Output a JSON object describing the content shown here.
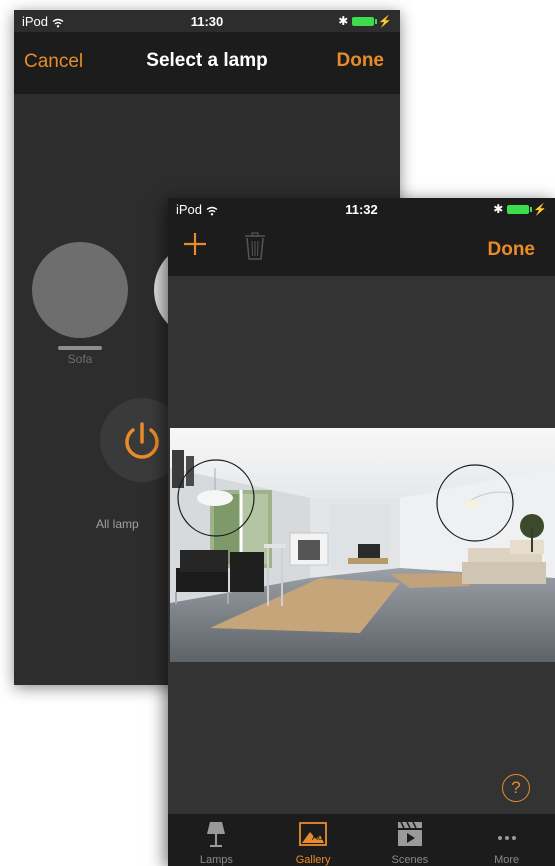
{
  "back_screen": {
    "status": {
      "carrier": "iPod",
      "time": "11:30"
    },
    "nav": {
      "cancel_label": "Cancel",
      "title": "Select a lamp",
      "done_label": "Done"
    },
    "lamps": [
      {
        "name": "Sofa"
      }
    ],
    "all_lamps_label": "All lamp"
  },
  "front_screen": {
    "status": {
      "carrier": "iPod",
      "time": "11:32"
    },
    "nav": {
      "done_label": "Done"
    },
    "help_label": "?",
    "tabs": [
      {
        "label": "Lamps",
        "icon": "lamp-icon",
        "active": false
      },
      {
        "label": "Gallery",
        "icon": "gallery-icon",
        "active": true
      },
      {
        "label": "Scenes",
        "icon": "scenes-icon",
        "active": false
      },
      {
        "label": "More",
        "icon": "more-icon",
        "active": false
      }
    ]
  },
  "colors": {
    "accent": "#e98b2a",
    "battery": "#3ddc4c",
    "nav_bg": "#1c1c1c"
  }
}
